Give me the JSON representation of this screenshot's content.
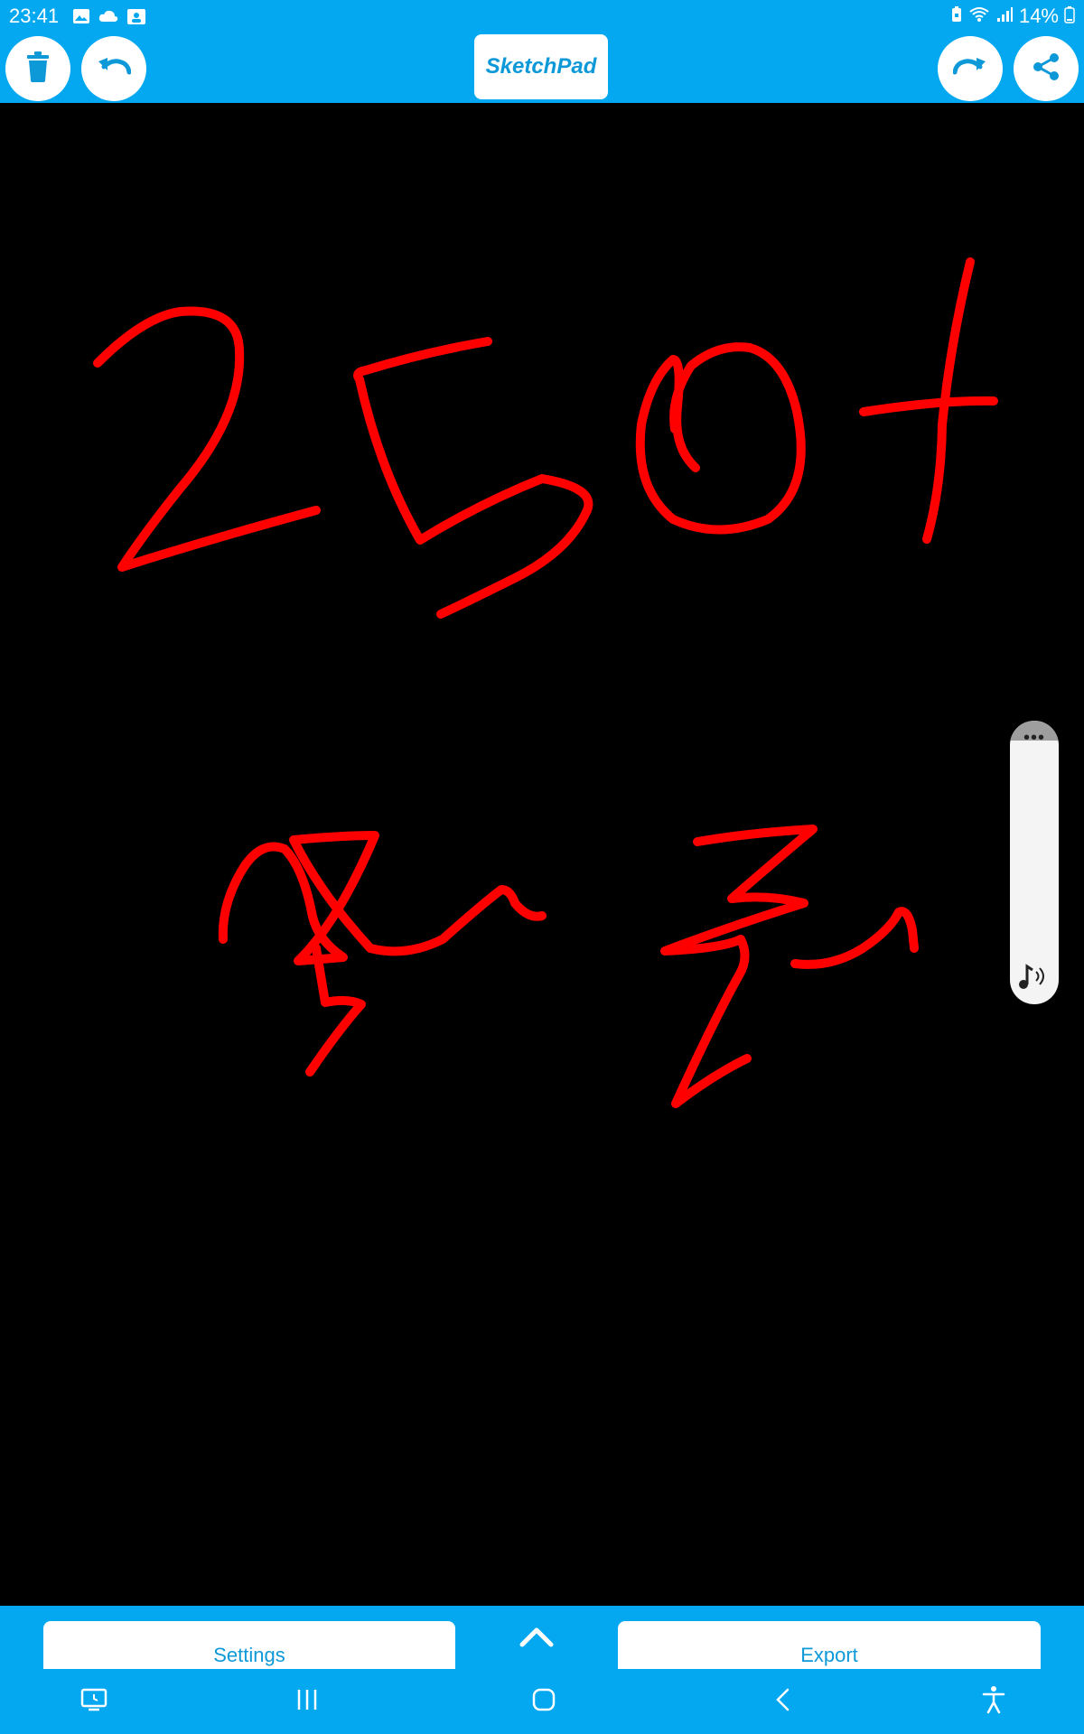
{
  "status_bar": {
    "time": "23:41",
    "left_icons": [
      "image-icon",
      "cloud-icon",
      "calendar-person-icon"
    ],
    "battery_text": "14%",
    "right_icons": [
      "battery-saver-icon",
      "wifi-icon",
      "signal-icon",
      "battery-icon"
    ]
  },
  "toolbar": {
    "title": "SketchPad",
    "buttons": [
      "delete-icon",
      "undo-icon",
      "redo-icon",
      "share-icon"
    ]
  },
  "canvas": {
    "background": "#000000",
    "stroke_color": "#ff0000"
  },
  "bottom_bar": {
    "settings_label": "Settings",
    "export_label": "Export"
  },
  "colors": {
    "accent": "#04a8f0",
    "accent_text": "#0d99d8",
    "white": "#ffffff"
  }
}
